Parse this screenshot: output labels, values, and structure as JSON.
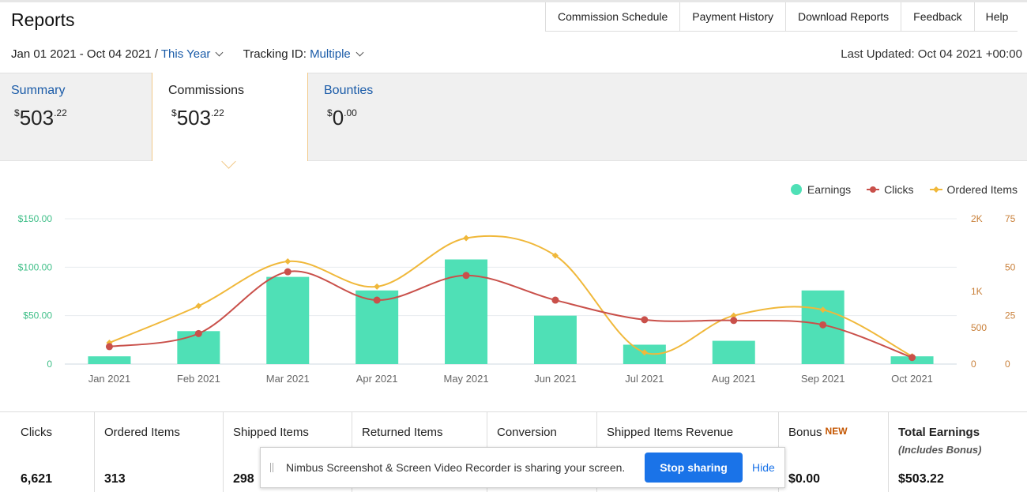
{
  "page": {
    "title": "Reports"
  },
  "topnav": [
    {
      "label": "Commission Schedule"
    },
    {
      "label": "Payment History"
    },
    {
      "label": "Download Reports"
    },
    {
      "label": "Feedback"
    },
    {
      "label": "Help"
    }
  ],
  "filters": {
    "date_range": "Jan 01 2021 - Oct 04 2021 /",
    "period": "This Year",
    "tracking_label": "Tracking ID:",
    "tracking_value": "Multiple",
    "last_updated": "Last Updated: Oct 04 2021 +00:00"
  },
  "tabs": [
    {
      "label": "Summary",
      "currency": "$",
      "whole": "503",
      "cents": ".22",
      "active": false
    },
    {
      "label": "Commissions",
      "currency": "$",
      "whole": "503",
      "cents": ".22",
      "active": true
    },
    {
      "label": "Bounties",
      "currency": "$",
      "whole": "0",
      "cents": ".00",
      "active": false
    }
  ],
  "legend": [
    {
      "label": "Earnings",
      "color": "#4fe0b6",
      "shape": "circle"
    },
    {
      "label": "Clicks",
      "color": "#c9504a",
      "shape": "dot-line"
    },
    {
      "label": "Ordered Items",
      "color": "#f0b83a",
      "shape": "diamond-line"
    }
  ],
  "chart_data": {
    "type": "bar",
    "categories": [
      "Jan 2021",
      "Feb 2021",
      "Mar 2021",
      "Apr 2021",
      "May 2021",
      "Jun 2021",
      "Jul 2021",
      "Aug 2021",
      "Sep 2021",
      "Oct 2021"
    ],
    "series": [
      {
        "name": "Earnings",
        "type": "bar",
        "axis": "left",
        "color": "#4fe0b6",
        "values": [
          8,
          34,
          90,
          76,
          108,
          50,
          20,
          24,
          76,
          8
        ]
      },
      {
        "name": "Clicks",
        "type": "line",
        "axis": "right1",
        "color": "#c9504a",
        "values": [
          240,
          420,
          1270,
          880,
          1220,
          880,
          610,
          600,
          540,
          90
        ]
      },
      {
        "name": "Ordered Items",
        "type": "line",
        "axis": "right2",
        "color": "#f0b83a",
        "values": [
          11,
          30,
          53,
          40,
          65,
          56,
          6,
          25,
          28,
          4
        ]
      }
    ],
    "y_left": {
      "min": 0,
      "max": 150,
      "ticks": [
        0,
        50,
        100,
        150
      ],
      "tick_labels": [
        "0",
        "$50.00",
        "$100.00",
        "$150.00"
      ]
    },
    "y_right1": {
      "min": 0,
      "max": 2000,
      "ticks": [
        0,
        500,
        1000,
        2000
      ],
      "tick_labels": [
        "0",
        "500",
        "1K",
        "2K"
      ]
    },
    "y_right2": {
      "min": 0,
      "max": 75,
      "ticks": [
        0,
        25,
        50,
        75
      ],
      "tick_labels": [
        "0",
        "25",
        "50",
        "75"
      ]
    },
    "grid": true,
    "legend_position": "top-right"
  },
  "stats": [
    {
      "label": "Clicks",
      "value": "6,621"
    },
    {
      "label": "Ordered Items",
      "value": "313"
    },
    {
      "label": "Shipped Items",
      "value": "298"
    },
    {
      "label": "Returned Items",
      "value": ""
    },
    {
      "label": "Conversion",
      "value": ""
    },
    {
      "label": "Shipped Items Revenue",
      "value": ""
    },
    {
      "label": "Bonus",
      "badge": "NEW",
      "value": "$0.00"
    },
    {
      "label": "Total Earnings",
      "sub": "(Includes Bonus)",
      "value": "$503.22"
    }
  ],
  "share_bar": {
    "message": "Nimbus Screenshot & Screen Video Recorder is sharing your screen.",
    "stop_label": "Stop sharing",
    "hide_label": "Hide"
  }
}
